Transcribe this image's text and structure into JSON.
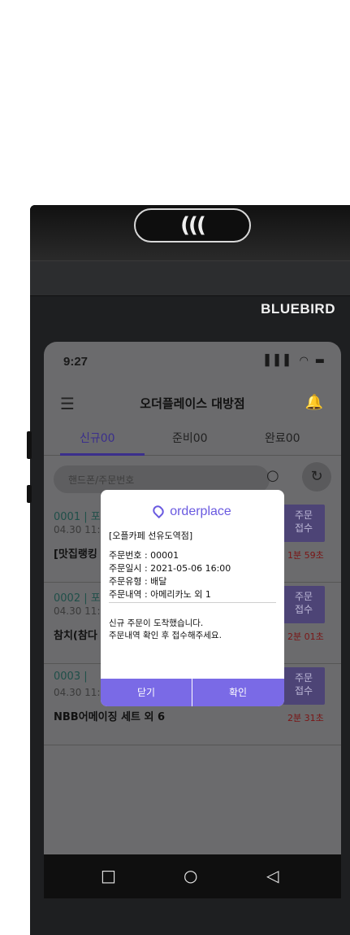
{
  "device": {
    "brand": "BLUEBIRD",
    "nfc_symbol": "((("
  },
  "status_bar": {
    "time": "9:27",
    "icons_text": "▌▌▌ ◠ ▬"
  },
  "app": {
    "title": "오더플레이스 대방점",
    "menu_icon": "☰",
    "bell_icon": "🔔"
  },
  "tabs": [
    {
      "label": "신규00",
      "active": true
    },
    {
      "label": "준비00",
      "active": false
    },
    {
      "label": "완료00",
      "active": false
    }
  ],
  "search": {
    "placeholder": "핸드폰/주문번호"
  },
  "orders": [
    {
      "num": "0001 | 포",
      "date": "04.30 11:0",
      "name": "[맛집랭킹",
      "accept": "주문\n접수",
      "timer": "1분 59초"
    },
    {
      "num": "0002 | 포",
      "date": "04.30 11:1",
      "name": "참치(참다",
      "accept": "주문\n접수",
      "timer": "2분 01초"
    },
    {
      "num": "0003 | ",
      "date": "04.30 11:2",
      "name": "NBB어메이징 세트 외 6",
      "accept": "주문\n접수",
      "timer": "2분 31초"
    }
  ],
  "nav_buttons": {
    "recent": "□",
    "home": "○",
    "back": "◁"
  },
  "modal": {
    "logo_text": "orderplace",
    "store": "[오플카페 선유도역점]",
    "details": [
      "주문번호 : 00001",
      "주문일시 : 2021-05-06 16:00",
      "주문유형 : 배달",
      "주문내역 : 아메리카노 외 1"
    ],
    "message": [
      "신규 주문이 도착했습니다.",
      "주문내역 확인 후 접수해주세요."
    ],
    "close_label": "닫기",
    "confirm_label": "확인"
  }
}
